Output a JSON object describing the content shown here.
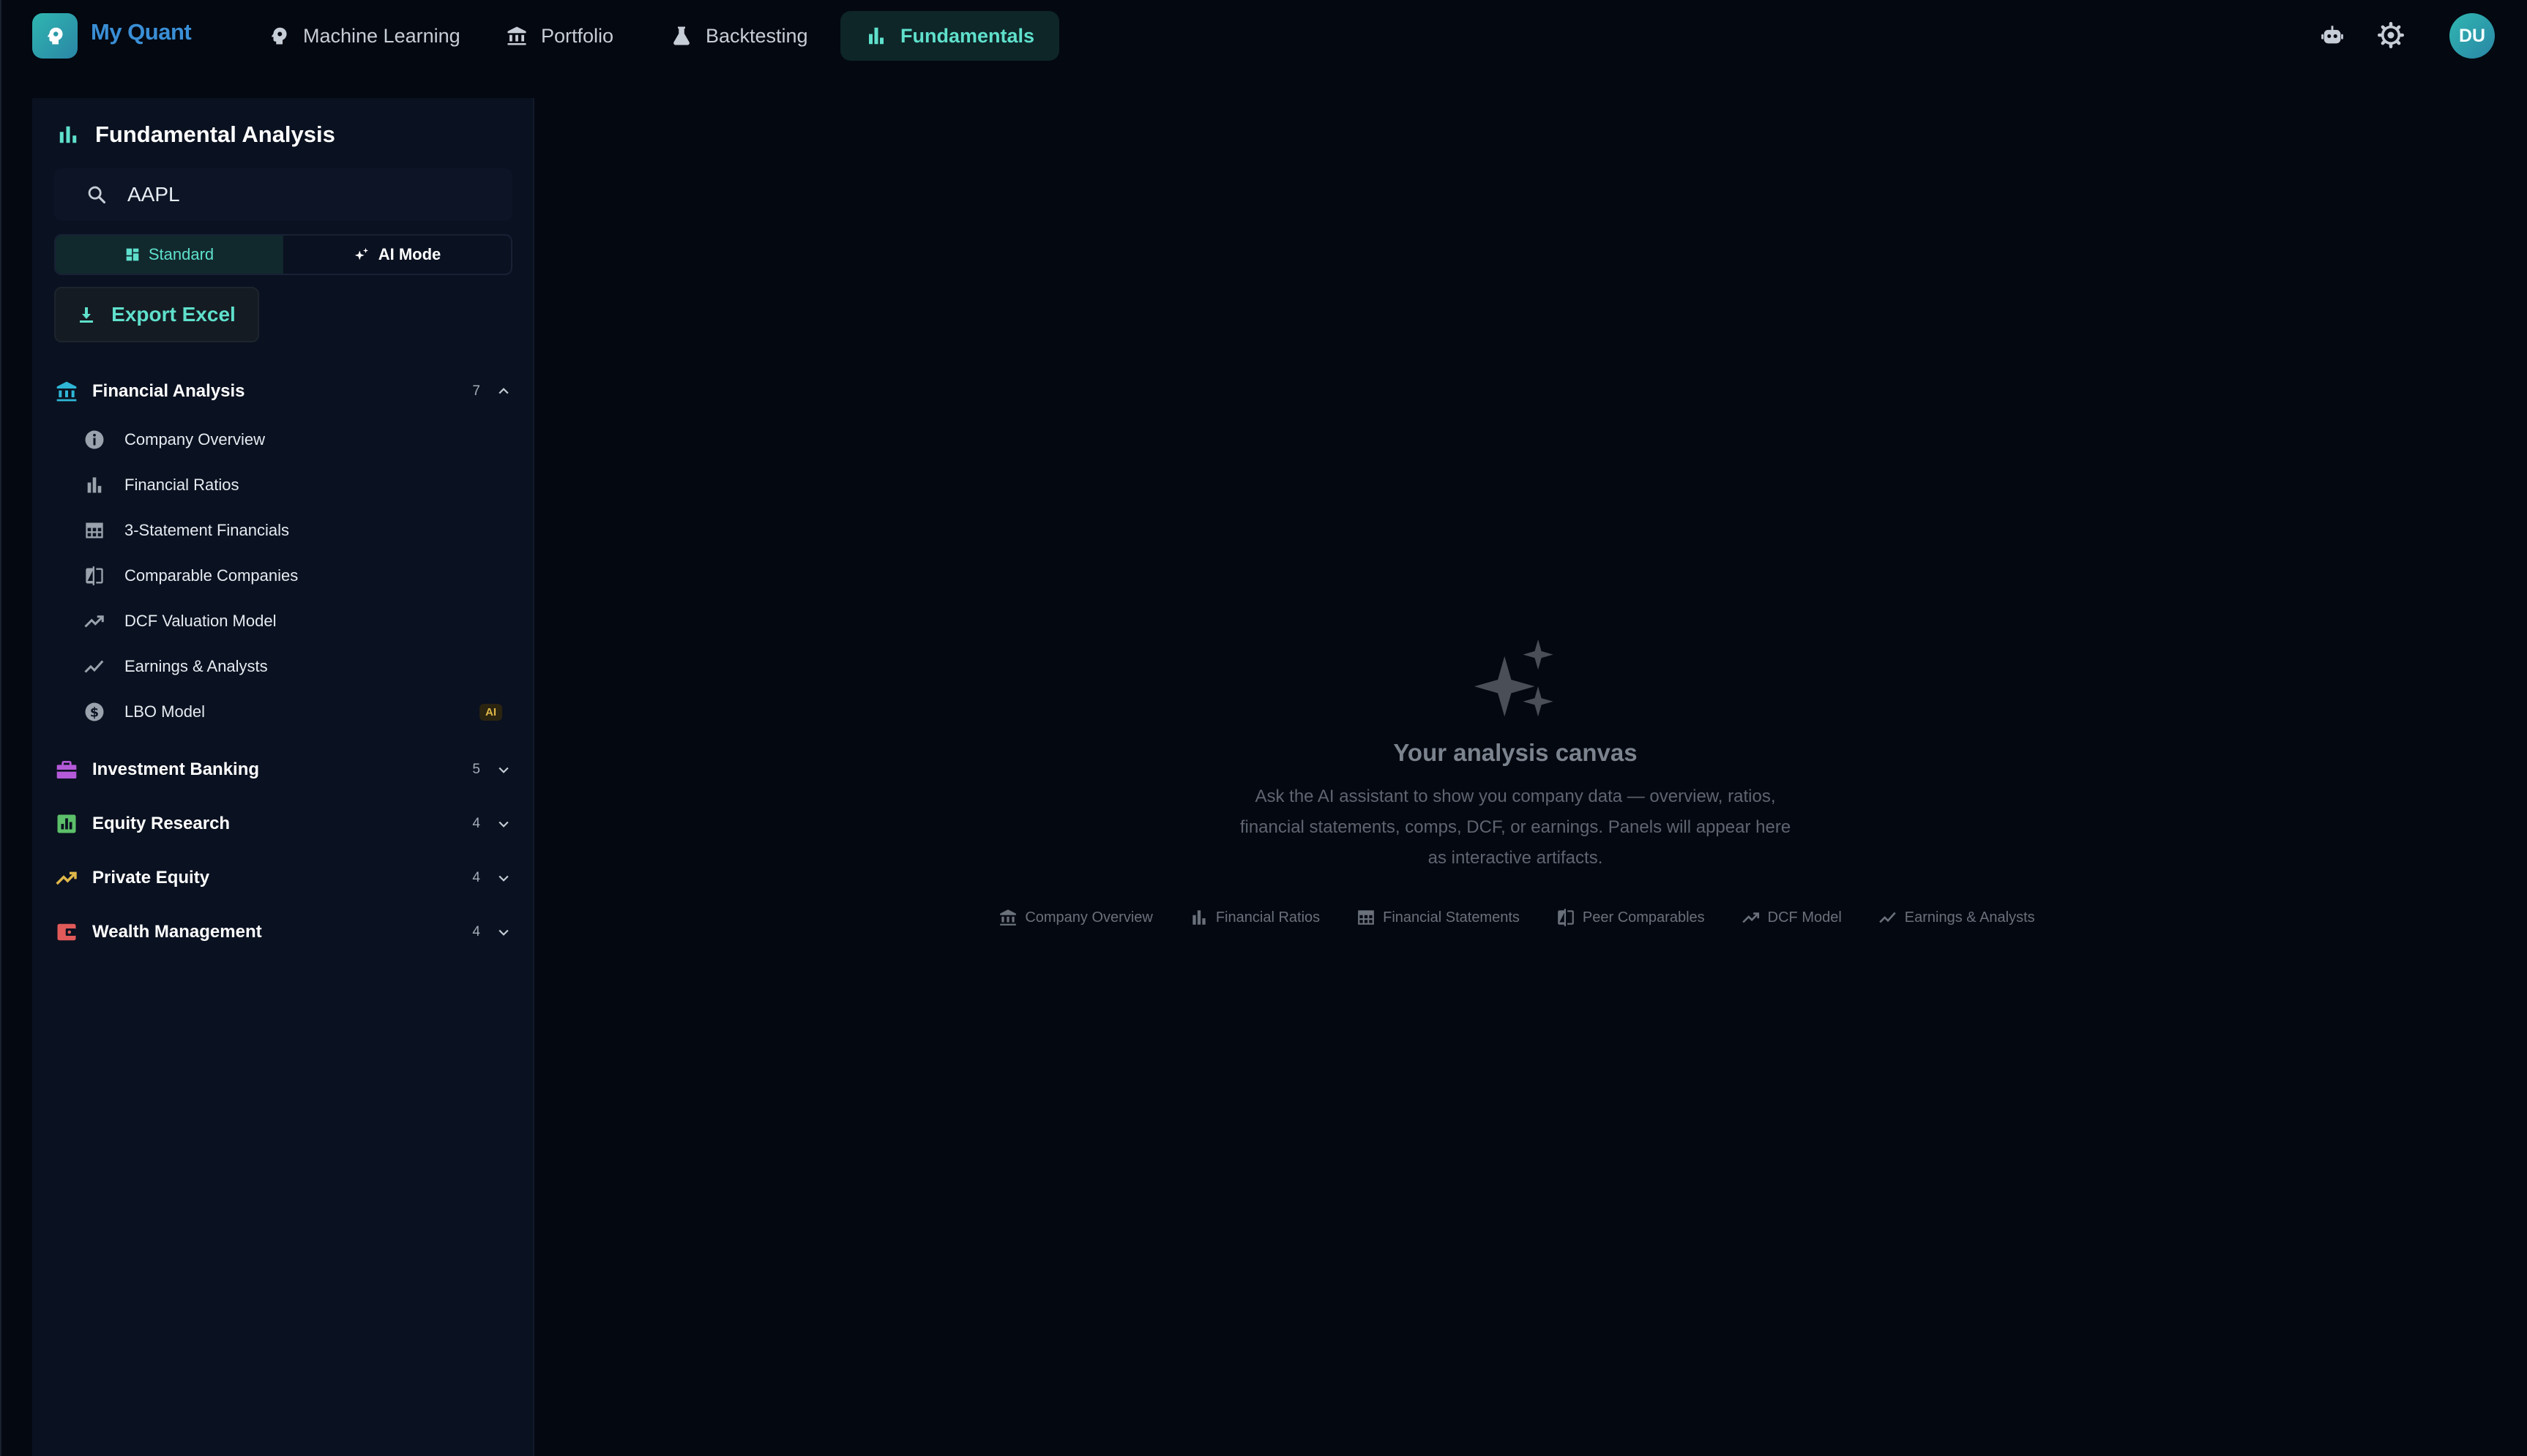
{
  "app": {
    "brand": "My Quant",
    "avatar_initials": "DU"
  },
  "nav": {
    "items": [
      {
        "label": "Machine Learning",
        "icon": "brain-icon"
      },
      {
        "label": "Portfolio",
        "icon": "bank-icon"
      },
      {
        "label": "Backtesting",
        "icon": "flask-icon"
      },
      {
        "label": "Fundamentals",
        "icon": "bar-chart-icon",
        "active": true
      }
    ]
  },
  "header_icons": [
    "robot-icon",
    "settings-icon"
  ],
  "sidebar": {
    "title": "Fundamental Analysis",
    "search": {
      "value": "AAPL",
      "placeholder": ""
    },
    "modes": {
      "standard": "Standard",
      "ai": "AI Mode",
      "selected": "Standard"
    },
    "export_label": "Export Excel",
    "groups": [
      {
        "label": "Financial Analysis",
        "count": "7",
        "expanded": true,
        "icon": "bank-icon",
        "color": "#2fb6d6",
        "items": [
          {
            "label": "Company Overview",
            "icon": "info-icon"
          },
          {
            "label": "Financial Ratios",
            "icon": "bar-chart-icon"
          },
          {
            "label": "3-Statement Financials",
            "icon": "table-icon"
          },
          {
            "label": "Comparable Companies",
            "icon": "compare-icon"
          },
          {
            "label": "DCF Valuation Model",
            "icon": "trending-up-icon"
          },
          {
            "label": "Earnings & Analysts",
            "icon": "line-chart-icon"
          },
          {
            "label": "LBO Model",
            "icon": "dollar-icon",
            "badge": "AI"
          }
        ]
      },
      {
        "label": "Investment Banking",
        "count": "5",
        "expanded": false,
        "icon": "briefcase-icon",
        "color": "#b45ad8"
      },
      {
        "label": "Equity Research",
        "count": "4",
        "expanded": false,
        "icon": "analytics-icon",
        "color": "#5cc06a"
      },
      {
        "label": "Private Equity",
        "count": "4",
        "expanded": false,
        "icon": "trending-up-icon",
        "color": "#e0b84a"
      },
      {
        "label": "Wealth Management",
        "count": "4",
        "expanded": false,
        "icon": "wallet-icon",
        "color": "#e05a5a"
      }
    ]
  },
  "canvas": {
    "title": "Your analysis canvas",
    "description": "Ask the AI assistant to show you company data — overview, ratios, financial statements, comps, DCF, or earnings. Panels will appear here as interactive artifacts.",
    "chips": [
      {
        "label": "Company Overview",
        "icon": "bank-icon"
      },
      {
        "label": "Financial Ratios",
        "icon": "bar-chart-icon"
      },
      {
        "label": "Financial Statements",
        "icon": "table-icon"
      },
      {
        "label": "Peer Comparables",
        "icon": "compare-icon"
      },
      {
        "label": "DCF Model",
        "icon": "trending-up-icon"
      },
      {
        "label": "Earnings & Analysts",
        "icon": "line-chart-icon"
      }
    ]
  },
  "colors": {
    "accent": "#5fe0cc",
    "brand": "#3a8fd6",
    "background": "#040811",
    "sidebar": "#0a1120"
  }
}
